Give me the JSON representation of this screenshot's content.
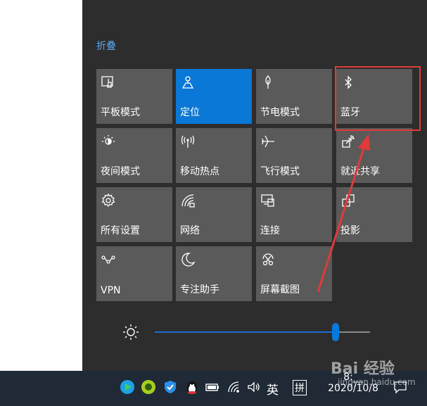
{
  "action_center": {
    "collapse_label": "折叠",
    "tiles": [
      {
        "label": "平板模式",
        "icon": "tablet-mode-icon",
        "active": false
      },
      {
        "label": "定位",
        "icon": "location-icon",
        "active": true
      },
      {
        "label": "节电模式",
        "icon": "battery-saver-icon",
        "active": false
      },
      {
        "label": "蓝牙",
        "icon": "bluetooth-icon",
        "active": false
      },
      {
        "label": "夜间模式",
        "icon": "night-light-icon",
        "active": false
      },
      {
        "label": "移动热点",
        "icon": "mobile-hotspot-icon",
        "active": false
      },
      {
        "label": "飞行模式",
        "icon": "airplane-icon",
        "active": false
      },
      {
        "label": "就近共享",
        "icon": "nearby-share-icon",
        "active": false
      },
      {
        "label": "所有设置",
        "icon": "settings-gear-icon",
        "active": false
      },
      {
        "label": "网络",
        "icon": "network-icon",
        "active": false
      },
      {
        "label": "连接",
        "icon": "connect-icon",
        "active": false
      },
      {
        "label": "投影",
        "icon": "project-icon",
        "active": false
      },
      {
        "label": "VPN",
        "icon": "vpn-icon",
        "active": false
      },
      {
        "label": "专注助手",
        "icon": "focus-assist-icon",
        "active": false
      },
      {
        "label": "屏幕截图",
        "icon": "screen-snip-icon",
        "active": false
      }
    ],
    "brightness": {
      "icon": "brightness-sun-icon",
      "level": 0.84
    }
  },
  "taskbar": {
    "ime_lang": "英",
    "ime_mode": "拼",
    "clock_time": "8:__",
    "clock_date": "2020/10/8",
    "tray_icons": [
      "video-app-icon",
      "green-app-icon",
      "security-shield-icon",
      "qq-penguin-icon",
      "battery-icon",
      "wifi-icon",
      "volume-icon",
      "notification-icon"
    ]
  },
  "watermark": {
    "brand": "Bai 经验",
    "url": "jingyan.baidu.com"
  },
  "colors": {
    "panel": "#2d2d2d",
    "tile": "#5a5a5a",
    "tile_active": "#0a78d7",
    "link": "#5aa7f0",
    "annotation_red": "#e03a3a",
    "taskbar": "#1f2a36"
  }
}
